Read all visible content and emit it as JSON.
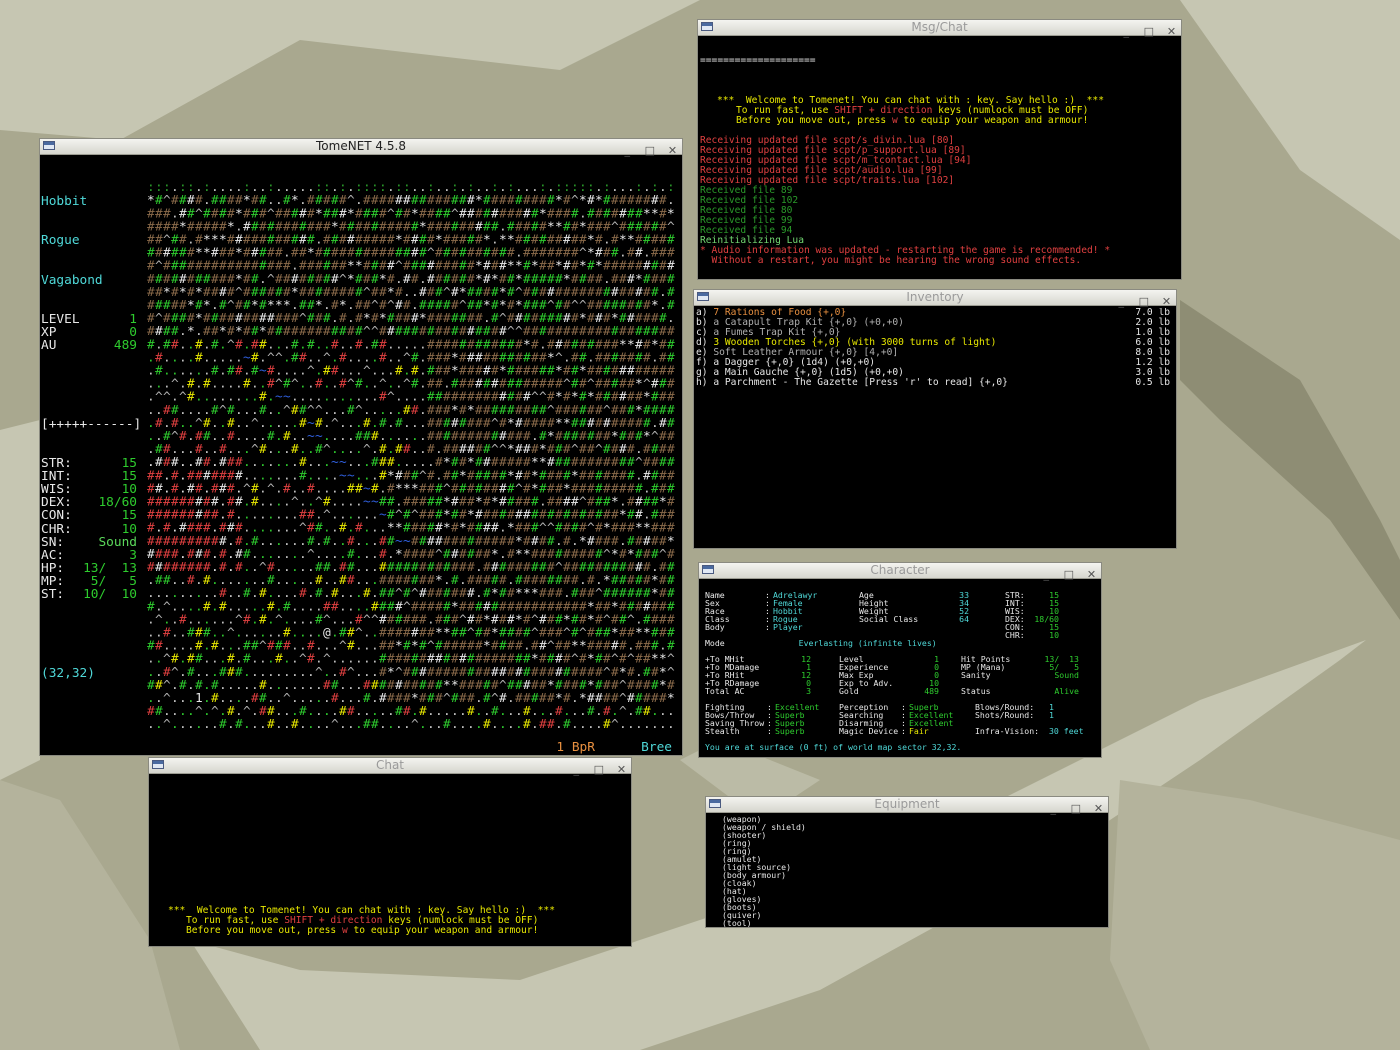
{
  "colors": {
    "desktop": "#a9a88f",
    "desktop_light": "#c6c6b2",
    "desktop_dark": "#8e8d74",
    "term_bg": "#000000"
  },
  "windows": {
    "main": {
      "title": "TomeNET 4.5.8"
    },
    "msg": {
      "title": "Msg/Chat"
    },
    "inventory": {
      "title": "Inventory"
    },
    "character": {
      "title": "Character"
    },
    "chat": {
      "title": "Chat"
    },
    "equipment": {
      "title": "Equipment"
    }
  },
  "controls": {
    "minimize": "_",
    "maximize": "□",
    "close": "✕"
  },
  "sidebar": {
    "race": "Hobbit",
    "class": "Rogue",
    "title": "Vagabond",
    "stats": [
      {
        "label": "LEVEL",
        "value": "1"
      },
      {
        "label": "XP",
        "value": "0"
      },
      {
        "label": "AU",
        "value": "489"
      }
    ],
    "bar": "[+++++------]",
    "attrs": [
      {
        "label": "STR:",
        "value": "15"
      },
      {
        "label": "INT:",
        "value": "15"
      },
      {
        "label": "WIS:",
        "value": "10"
      },
      {
        "label": "DEX:",
        "value": "18/60"
      },
      {
        "label": "CON:",
        "value": "15"
      },
      {
        "label": "CHR:",
        "value": "10"
      },
      {
        "label": "SN:",
        "value": "Sound"
      },
      {
        "label": "AC:",
        "value": "3"
      },
      {
        "label": "HP:",
        "value": "13/  13"
      },
      {
        "label": "MP:",
        "value": "5/   5"
      },
      {
        "label": "ST:",
        "value": "10/  10"
      }
    ],
    "coords": "(32,32)"
  },
  "map": {
    "player": "@",
    "label": "1",
    "bpr": "1 BpR",
    "location": "Bree"
  },
  "msg": {
    "separator": "====================",
    "welcome": "***  Welcome to Tomenet! You can chat with : key. Say hello :)  ***",
    "runfast_a": "To run fast, use ",
    "runfast_b": "SHIFT + direction",
    "runfast_c": " keys (numlock must be OFF)",
    "equip_a": "Before you move out, press ",
    "equip_b": "w",
    "equip_c": " to equip your weapon and armour!",
    "receiving": [
      "Receiving updated file scpt/s_divin.lua [80]",
      "Receiving updated file scpt/p_support.lua [89]",
      "Receiving updated file scpt/m_tcontact.lua [94]",
      "Receiving updated file scpt/audio.lua [99]",
      "Receiving updated file scpt/traits.lua [102]"
    ],
    "received": [
      "Received file 89",
      "Received file 102",
      "Received file 80",
      "Received file 99",
      "Received file 94"
    ],
    "reinit": "Reinitializing Lua",
    "audio1": "* Audio information was updated - restarting the game is recommended! *",
    "audio2": "  Without a restart, you might be hearing the wrong sound effects."
  },
  "inventory": [
    {
      "slot": "a)",
      "name": "7 Rations of Food {+,0}",
      "weight": "7.0 lb"
    },
    {
      "slot": "b)",
      "name": "a Catapult Trap Kit {+,0} (+0,+0)",
      "weight": "2.0 lb"
    },
    {
      "slot": "c)",
      "name": "a Fumes Trap Kit {+,0}",
      "weight": "1.0 lb"
    },
    {
      "slot": "d)",
      "name": "3 Wooden Torches {+,0} (with 3000 turns of light)",
      "weight": "6.0 lb"
    },
    {
      "slot": "e)",
      "name": "Soft Leather Armour {+,0} [4,+0]",
      "weight": "8.0 lb"
    },
    {
      "slot": "f)",
      "name": "a Dagger {+,0} (1d4) (+0,+0)",
      "weight": "1.2 lb"
    },
    {
      "slot": "g)",
      "name": "a Main Gauche {+,0} (1d5) (+0,+0)",
      "weight": "3.0 lb"
    },
    {
      "slot": "h)",
      "name": "a Parchment - The Gazette [Press 'r' to read] {+,0}",
      "weight": "0.5 lb"
    }
  ],
  "character": {
    "info_labels": [
      "Name",
      ":",
      "Sex",
      ":",
      "Race",
      ":",
      "Class",
      ":",
      "Body",
      ":"
    ],
    "info": [
      {
        "label": "Name",
        "value": "Adrelawyr"
      },
      {
        "label": "Sex",
        "value": "Female"
      },
      {
        "label": "Race",
        "value": "Hobbit"
      },
      {
        "label": "Class",
        "value": "Rogue"
      },
      {
        "label": "Body",
        "value": "Player"
      }
    ],
    "phys": [
      {
        "label": "Age",
        "value": "33"
      },
      {
        "label": "Height",
        "value": "34"
      },
      {
        "label": "Weight",
        "value": "52"
      },
      {
        "label": "Social Class",
        "value": "64"
      }
    ],
    "stats": [
      {
        "label": "STR:",
        "value": "15"
      },
      {
        "label": "INT:",
        "value": "15"
      },
      {
        "label": "WIS:",
        "value": "10"
      },
      {
        "label": "DEX:",
        "value": "18/60"
      },
      {
        "label": "CON:",
        "value": "15"
      },
      {
        "label": "CHR:",
        "value": "10"
      }
    ],
    "mode_label": "Mode",
    "mode_value": "Everlasting (infinite lives)",
    "combat": [
      {
        "label": "+To MHit",
        "value": "12"
      },
      {
        "label": "+To MDamage",
        "value": "1"
      },
      {
        "label": "+To RHit",
        "value": "12"
      },
      {
        "label": "+To RDamage",
        "value": "0"
      },
      {
        "label": "Total AC",
        "value": "3"
      }
    ],
    "progress": [
      {
        "label": "Level",
        "value": "1"
      },
      {
        "label": "Experience",
        "value": "0"
      },
      {
        "label": "Max Exp",
        "value": "0"
      },
      {
        "label": "Exp to Adv.",
        "value": "10"
      },
      {
        "label": "Gold",
        "value": "489"
      }
    ],
    "vitals": [
      {
        "label": "Hit Points",
        "value": "13/  13"
      },
      {
        "label": "MP (Mana)",
        "value": "5/   5"
      },
      {
        "label": "Sanity",
        "value": "Sound"
      },
      {
        "label": "",
        "value": ""
      },
      {
        "label": "Status",
        "value": "Alive"
      }
    ],
    "skills1": [
      {
        "label": "Fighting",
        "value": "Excellent"
      },
      {
        "label": "Bows/Throw",
        "value": "Superb"
      },
      {
        "label": "Saving Throw",
        "value": "Superb"
      },
      {
        "label": "Stealth",
        "value": "Superb"
      }
    ],
    "skills2": [
      {
        "label": "Perception",
        "value": "Superb"
      },
      {
        "label": "Searching",
        "value": "Excellent"
      },
      {
        "label": "Disarming",
        "value": "Excellent"
      },
      {
        "label": "Magic Device",
        "value": "Fair"
      }
    ],
    "blows": [
      {
        "label": "Blows/Round:",
        "value": "1"
      },
      {
        "label": "Shots/Round:",
        "value": "1"
      },
      {
        "label": "",
        "value": ""
      },
      {
        "label": "Infra-Vision:",
        "value": "30 feet"
      }
    ],
    "location": "You are at surface (0 ft) of world map sector 32,32."
  },
  "chat": {
    "welcome": "***  Welcome to Tomenet! You can chat with : key. Say hello :)  ***",
    "runfast_a": "To run fast, use ",
    "runfast_b": "SHIFT + direction",
    "runfast_c": " keys (numlock must be OFF)",
    "equip_a": "Before you move out, press ",
    "equip_b": "w",
    "equip_c": " to equip your weapon and armour!"
  },
  "equipment": [
    "(weapon)",
    "(weapon / shield)",
    "(shooter)",
    "(ring)",
    "(ring)",
    "(amulet)",
    "(light source)",
    "(body armour)",
    "(cloak)",
    "(hat)",
    "(gloves)",
    "(boots)",
    "(quiver)",
    "(tool)"
  ]
}
